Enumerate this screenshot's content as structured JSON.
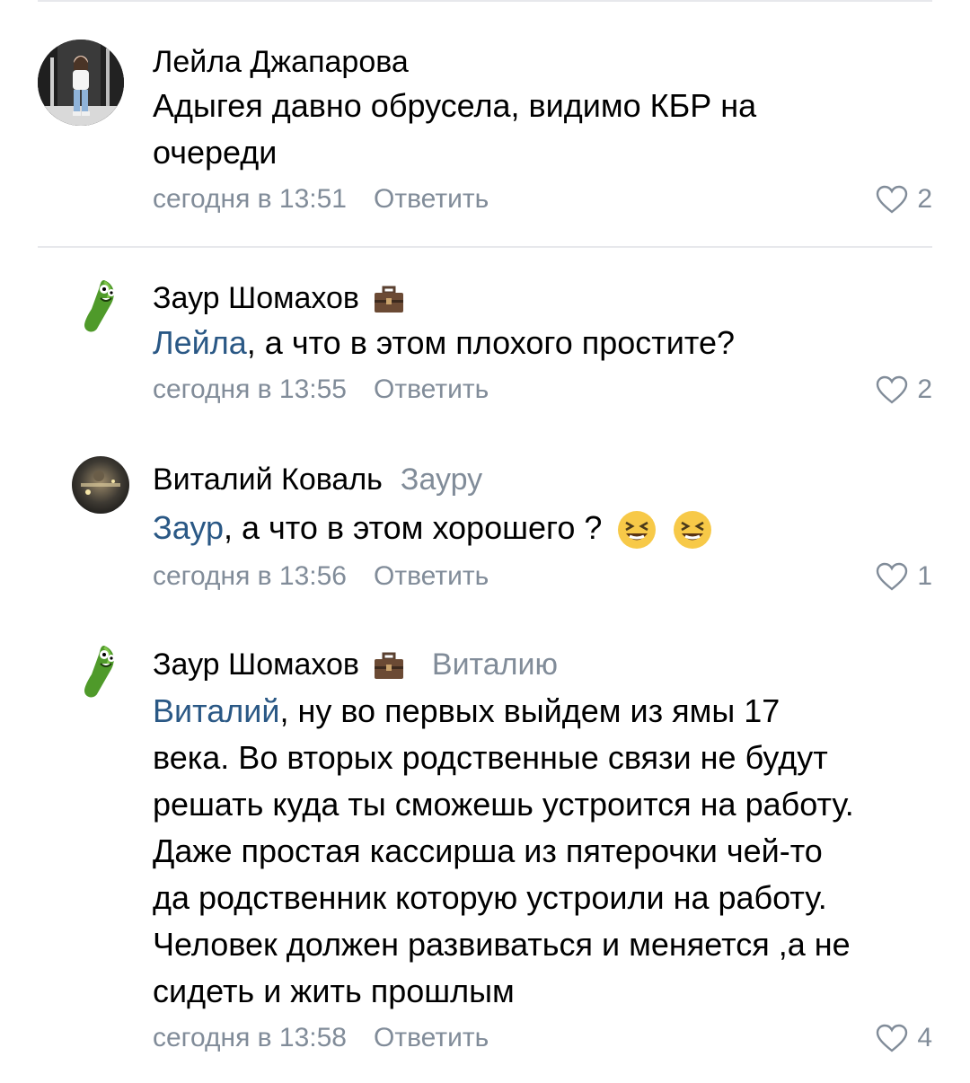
{
  "comments": [
    {
      "author": "Лейла Джапарова",
      "text_line1": "Адыгея давно обрусела, видимо КБР на",
      "text_line2": "очереди",
      "time": "сегодня в 13:51",
      "reply_label": "Ответить",
      "likes": "2",
      "avatar_icon": "photo-avatar-icon"
    },
    {
      "author": "Заур Шомахов",
      "mention": "Лейла",
      "text": ", а что в этом плохого простите?",
      "time": "сегодня в 13:55",
      "reply_label": "Ответить",
      "likes": "2",
      "avatar_icon": "pickle-avatar-icon",
      "badge_icon": "briefcase-icon"
    },
    {
      "author": "Виталий Коваль",
      "reply_to": "Зауру",
      "mention": "Заур",
      "text": ", а что в этом хорошего ?",
      "time": "сегодня в 13:56",
      "reply_label": "Ответить",
      "likes": "1",
      "avatar_icon": "night-photo-avatar-icon",
      "emoji_icon": "laughing-face-icon"
    },
    {
      "author": "Заур Шомахов",
      "reply_to": "Виталию",
      "mention": "Виталий",
      "text_line1": ", ну во первых выйдем из ямы 17",
      "text_lines": [
        "века. Во вторых родственные связи не будут",
        "решать куда ты сможешь устроится на работу.",
        "Даже простая кассирша из пятерочки чей-то",
        "да родственник которую устроили на работу.",
        "Человек должен развиваться и меняется ,а не",
        "сидеть и жить прошлым"
      ],
      "time": "сегодня в 13:58",
      "reply_label": "Ответить",
      "likes": "4",
      "avatar_icon": "pickle-avatar-icon",
      "badge_icon": "briefcase-icon"
    }
  ],
  "colors": {
    "link": "#2a5885",
    "secondary": "#818c99",
    "divider": "#e7e8ec"
  }
}
